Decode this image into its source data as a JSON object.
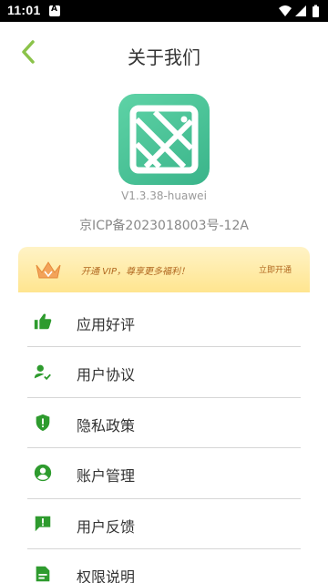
{
  "status_bar": {
    "time": "11:01"
  },
  "header": {
    "title": "关于我们"
  },
  "app": {
    "version": "V1.3.38-huawei",
    "icp": "京ICP备2023018003号-12A"
  },
  "vip_banner": {
    "text": "开通 VIP，尊享更多福利！",
    "action": "立即开通"
  },
  "menu": {
    "items": [
      {
        "label": "应用好评",
        "icon": "thumbs-up-icon"
      },
      {
        "label": "用户协议",
        "icon": "user-check-icon"
      },
      {
        "label": "隐私政策",
        "icon": "shield-icon"
      },
      {
        "label": "账户管理",
        "icon": "account-icon"
      },
      {
        "label": "用户反馈",
        "icon": "feedback-icon"
      },
      {
        "label": "权限说明",
        "icon": "permission-icon"
      }
    ]
  },
  "colors": {
    "accent": "#8bc34a",
    "icon_green": "#2e9b2e",
    "app_icon": "#45c194",
    "vip_text": "#b0661e"
  }
}
